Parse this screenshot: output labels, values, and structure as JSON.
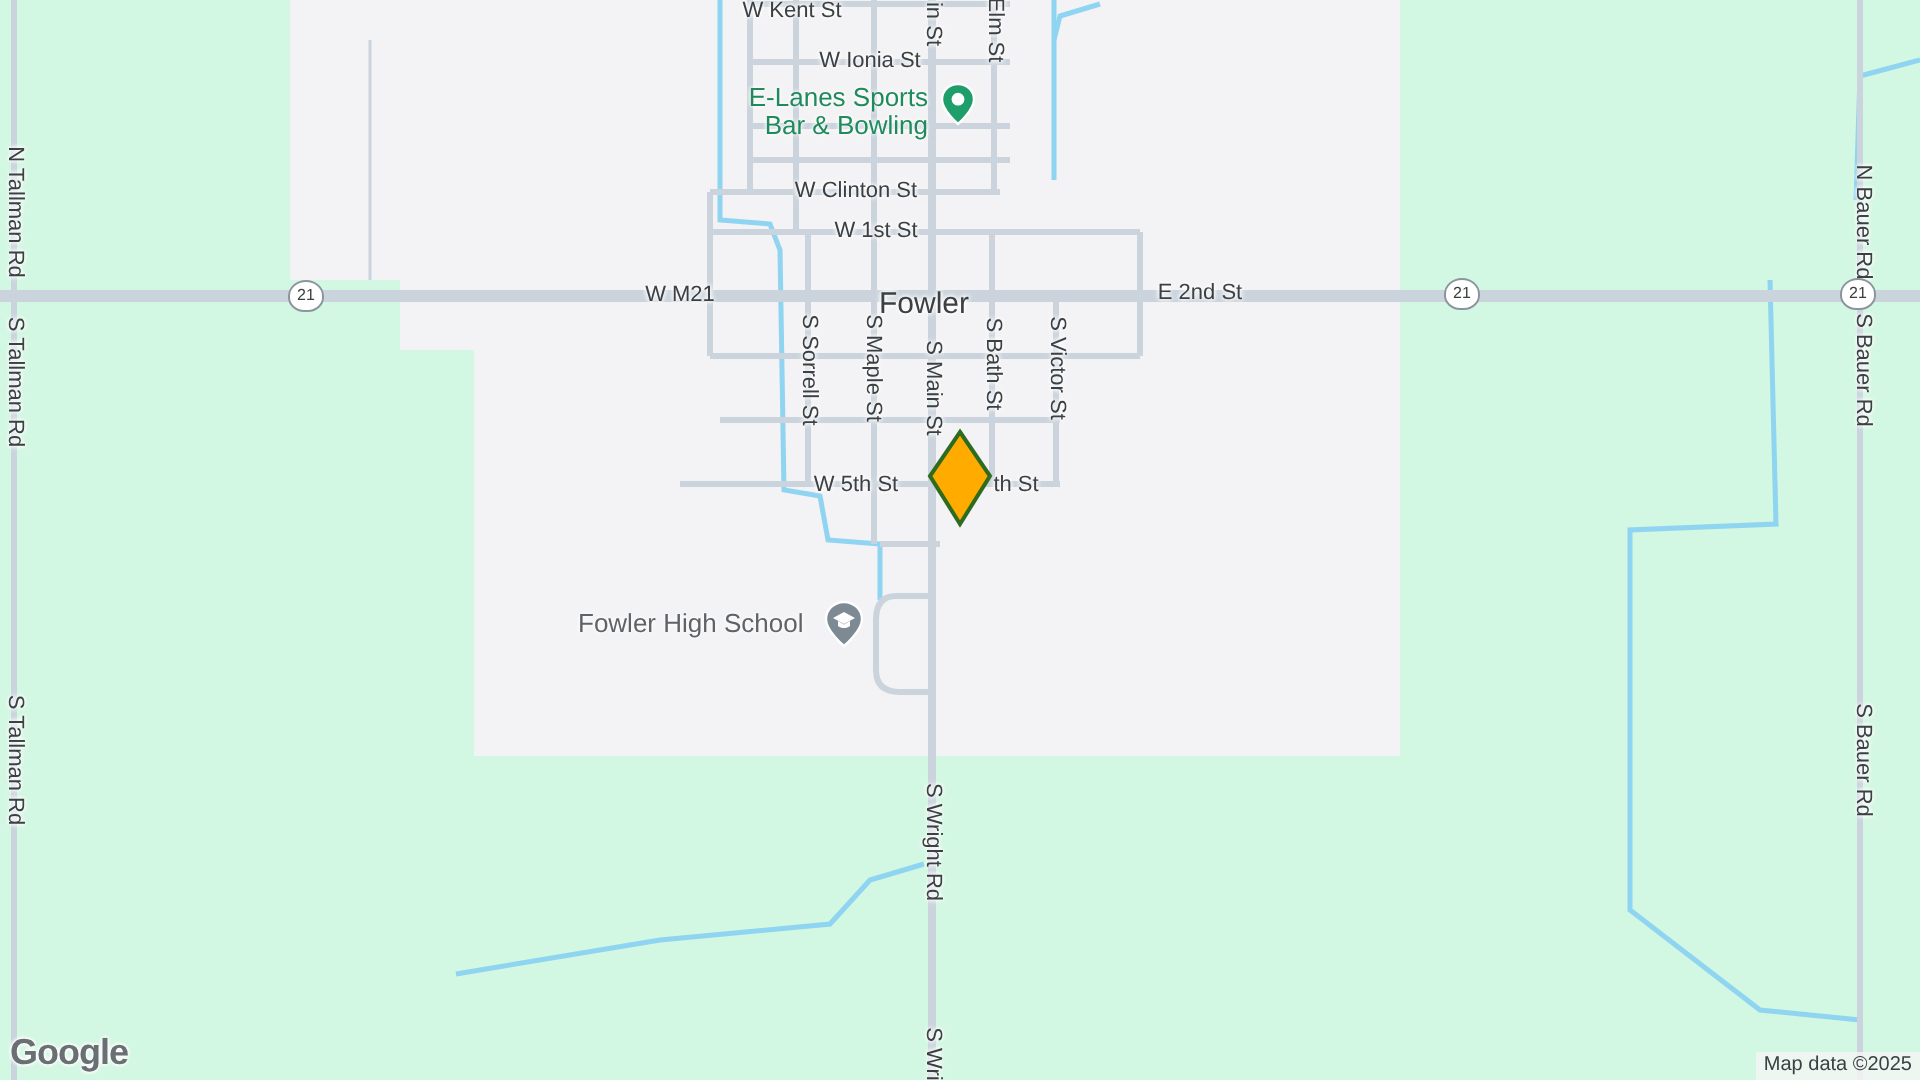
{
  "map": {
    "labels": [
      {
        "kind": "street",
        "text": "W Kent St"
      },
      {
        "kind": "street-v",
        "text": "in St"
      },
      {
        "kind": "street-v",
        "text": "Elm St"
      },
      {
        "kind": "street",
        "text": "W Ionia St"
      },
      {
        "kind": "street",
        "text": "W Clinton St"
      },
      {
        "kind": "street",
        "text": "W 1st St"
      },
      {
        "kind": "street",
        "text": "W M21"
      },
      {
        "kind": "town",
        "text": "Fowler"
      },
      {
        "kind": "street",
        "text": "E 2nd St"
      },
      {
        "kind": "street-v",
        "text": "N Tallman Rd"
      },
      {
        "kind": "street-v",
        "text": "S Tallman Rd"
      },
      {
        "kind": "street-v",
        "text": "S Tallman Rd"
      },
      {
        "kind": "street-v",
        "text": "N Bauer Rd"
      },
      {
        "kind": "street-v",
        "text": "S Bauer Rd"
      },
      {
        "kind": "street-v",
        "text": "S Bauer Rd"
      },
      {
        "kind": "street-v",
        "text": "S Sorrell St"
      },
      {
        "kind": "street-v",
        "text": "S Maple St"
      },
      {
        "kind": "street-v",
        "text": "S Main St"
      },
      {
        "kind": "street-v",
        "text": "S Bath St"
      },
      {
        "kind": "street-v",
        "text": "S Victor St"
      },
      {
        "kind": "street",
        "text": "W 5th St"
      },
      {
        "kind": "street",
        "text": "th St"
      },
      {
        "kind": "street-v",
        "text": "S Wright Rd"
      },
      {
        "kind": "street-v",
        "text": "S Wri"
      }
    ],
    "shields": [
      {
        "text": "21"
      },
      {
        "text": "21"
      },
      {
        "text": "21"
      }
    ],
    "places": [
      {
        "kind": "bar",
        "name": "E-Lanes Sports Bar & Bowling"
      },
      {
        "kind": "school",
        "name": "Fowler High School"
      }
    ],
    "logo": "Google",
    "attribution": "Map data ©2025"
  }
}
